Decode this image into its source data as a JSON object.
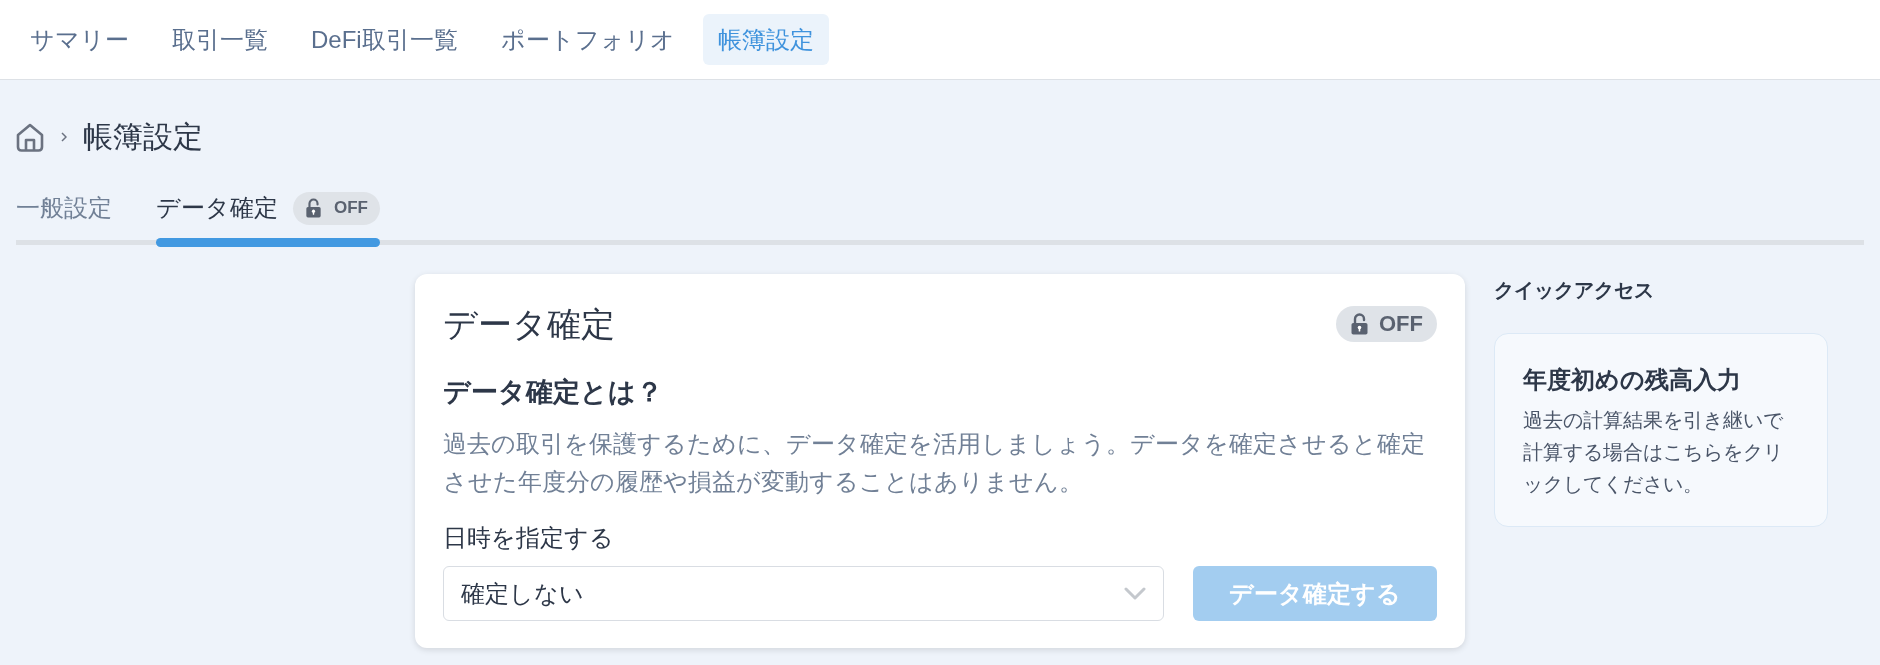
{
  "nav": {
    "items": [
      {
        "label": "サマリー",
        "selected": false
      },
      {
        "label": "取引一覧",
        "selected": false
      },
      {
        "label": "DeFi取引一覧",
        "selected": false
      },
      {
        "label": "ポートフォリオ",
        "selected": false
      },
      {
        "label": "帳簿設定",
        "selected": true
      }
    ]
  },
  "breadcrumb": {
    "title": "帳簿設定"
  },
  "tabs": [
    {
      "label": "一般設定",
      "selected": false
    },
    {
      "label": "データ確定",
      "selected": true,
      "badge": {
        "text": "OFF",
        "locked": false
      }
    }
  ],
  "card": {
    "title": "データ確定",
    "badge": {
      "text": "OFF",
      "locked": false
    },
    "subtitle": "データ確定とは？",
    "description": "過去の取引を保護するために、データ確定を活用しましょう。データを確定させると確定させた年度分の履歴や損益が変動することはありません。",
    "date_field": {
      "label": "日時を指定する",
      "value": "確定しない"
    },
    "button": {
      "label": "データ確定する",
      "disabled": true
    }
  },
  "quick_access": {
    "heading": "クイックアクセス",
    "items": [
      {
        "title": "年度初めの残高入力",
        "description": "過去の計算結果を引き継いで計算する場合はこちらをクリックしてください。"
      }
    ]
  }
}
